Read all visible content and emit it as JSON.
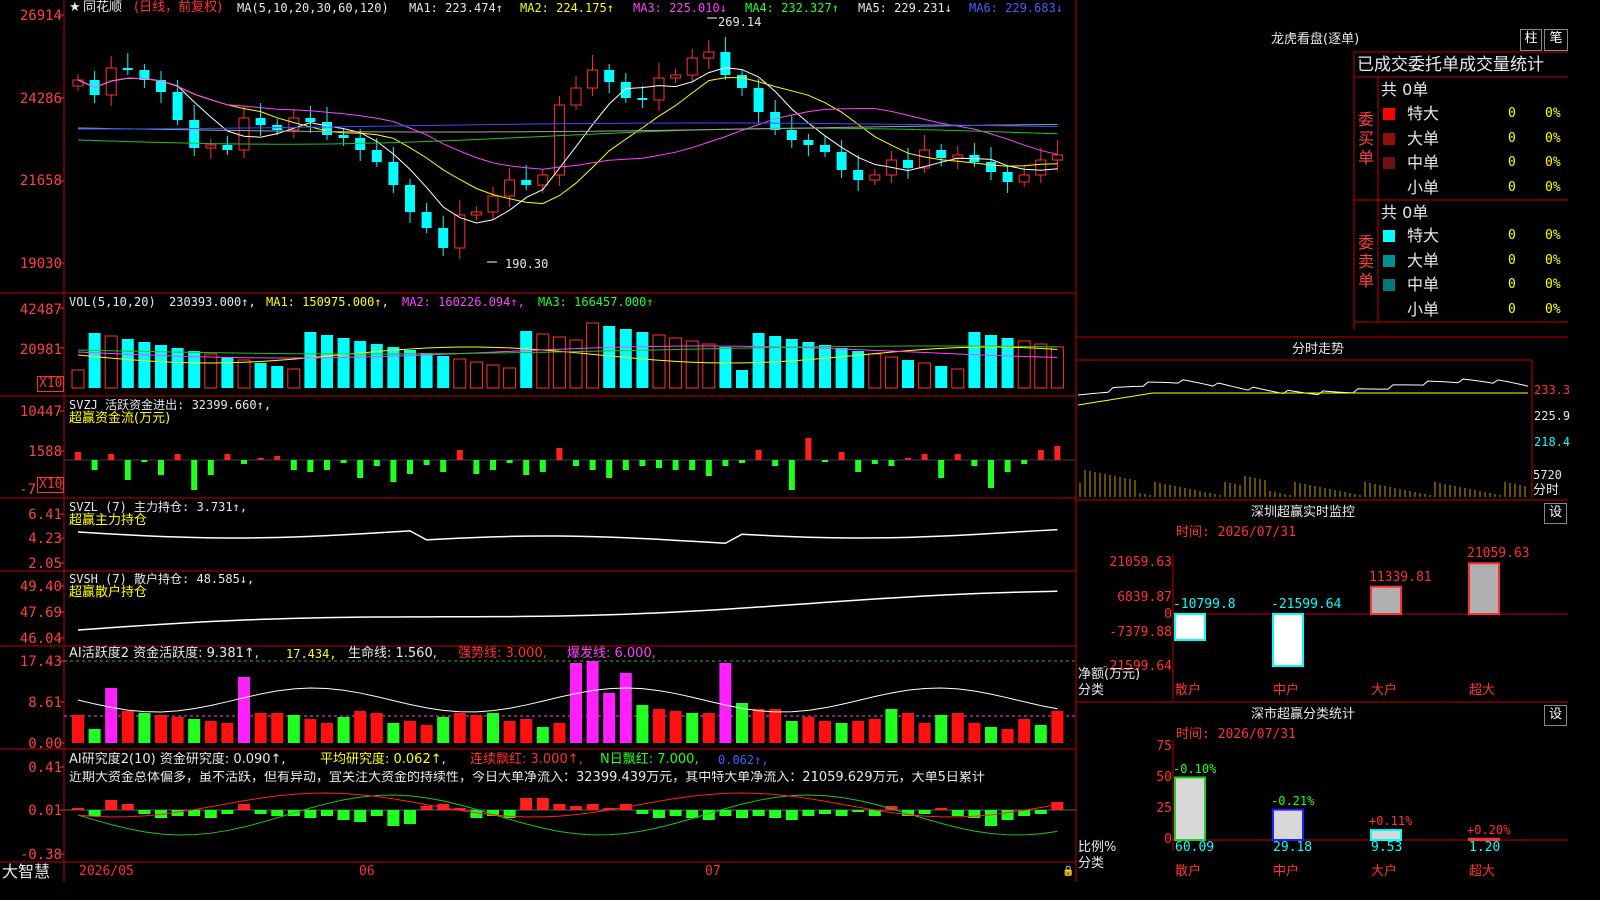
{
  "price_panel": {
    "axis": [
      "26914",
      "24286",
      "21658",
      "19030"
    ],
    "star": "★",
    "stock": "同花顺",
    "mode": "(日线，前复权)",
    "ma_title": "MA(5,10,20,30,60,120)",
    "ma1": "MA1: 223.474↑",
    "ma2": "MA2: 224.175↑",
    "ma3": "MA3: 225.010↓",
    "ma4": "MA4: 232.327↑",
    "ma5": "MA5: 229.231↓",
    "ma6": "MA6: 229.683↓",
    "high_mark": "269.14",
    "low_mark": "190.30"
  },
  "vol_panel": {
    "axis": [
      "42487",
      "20981"
    ],
    "multiplier": "X10",
    "title": "VOL(5,10,20)",
    "value": "230393.000↑,",
    "ma1": "MA1: 150975.000↑,",
    "ma2": "MA2: 160226.094↑,",
    "ma3": "MA3: 166457.000↑"
  },
  "svzj_panel": {
    "axis": [
      "10447",
      "1588",
      "-7"
    ],
    "multiplier": "X10",
    "line1": "SVZJ  活跃资金进出: 32399.660↑,",
    "line2": "超赢资金流(万元)"
  },
  "svzl_panel": {
    "axis": [
      "6.41",
      "4.23",
      "2.05"
    ],
    "line1": "SVZL (7) 主力持仓: 3.731↑,",
    "line2": "超赢主力持仓"
  },
  "svsh_panel": {
    "axis": [
      "49.40",
      "47.69",
      "46.04"
    ],
    "line1": "SVSH (7) 散户持仓: 48.585↓,",
    "line2": "超赢散户持仓"
  },
  "ai2_panel": {
    "axis": [
      "17.43",
      "8.61",
      "0.00"
    ],
    "t1": "AI活跃度2 资金活跃度: 9.381↑,",
    "t2": "17.434,",
    "t3": "生命线: 1.560,",
    "t4": "强势线: 3.000,",
    "t5": "爆发线: 6.000,"
  },
  "ai_research_panel": {
    "axis": [
      "0.41",
      "0.01",
      "-0.38"
    ],
    "t1": "AI研究度2(10) 资金研究度: 0.090↑,",
    "t2": "平均研究度: 0.062↑,",
    "t3": "连续飘红: 3.000↑,",
    "t4": "N日飘红: 7.000,",
    "t5": "0.062↑,",
    "comment": "近期大资金总体偏多，虽不活跃，但有异动，宜关注大资金的持续性，今日大单净流入：32399.439万元，其中特大单净流入：21059.629万元，大单5日累计"
  },
  "date_axis": {
    "brand": "大智慧",
    "d1": "2026/05",
    "d2": "06",
    "d3": "07"
  },
  "longhu": {
    "title": "龙虎看盘(逐单)",
    "btn_bar": "柱",
    "btn_pen": "笔",
    "subtitle": "已成交委托单成交量统计",
    "buy_label": "委买单",
    "sell_label": "委卖单",
    "buy_total": "共 0单",
    "sell_total": "共 0单",
    "buy_rows": [
      {
        "name": "特大",
        "count": "0",
        "pct": "0%",
        "color": "#ff0000"
      },
      {
        "name": "大单",
        "count": "0",
        "pct": "0%",
        "color": "#901010"
      },
      {
        "name": "中单",
        "count": "0",
        "pct": "0%",
        "color": "#701010"
      },
      {
        "name": "小单",
        "count": "0",
        "pct": "0%",
        "color": "#000000"
      }
    ],
    "sell_rows": [
      {
        "name": "特大",
        "count": "0",
        "pct": "0%",
        "color": "#00ffff"
      },
      {
        "name": "大单",
        "count": "0",
        "pct": "0%",
        "color": "#009090"
      },
      {
        "name": "中单",
        "count": "0",
        "pct": "0%",
        "color": "#007878"
      },
      {
        "name": "小单",
        "count": "0",
        "pct": "0%",
        "color": "#000000"
      }
    ]
  },
  "intraday": {
    "title": "分时走势",
    "p1": "233.3",
    "p2": "225.9",
    "p3": "218.4",
    "vol": "5720",
    "unit": "分时"
  },
  "monitor": {
    "title": "深圳超赢实时监控",
    "btn": "设",
    "time": "时间: 2026/07/31",
    "axis": [
      "21059.63",
      "6839.87",
      "0",
      "-7379.88",
      "-21599.64"
    ],
    "ylabel1": "净额(万元)",
    "ylabel2": "分类",
    "bars": [
      {
        "label": "散户",
        "value": "-10799.8"
      },
      {
        "label": "中户",
        "value": "-21599.64"
      },
      {
        "label": "大户",
        "value": "11339.81"
      },
      {
        "label": "超大",
        "value": "21059.63"
      }
    ]
  },
  "classify": {
    "title": "深市超赢分类统计",
    "btn": "设",
    "time": "时间: 2026/07/31",
    "axis": [
      "75",
      "50",
      "25",
      "0"
    ],
    "ylabel1": "比例%",
    "ylabel2": "分类",
    "bars": [
      {
        "label": "散户",
        "value": "60.09",
        "change": "-0.10%"
      },
      {
        "label": "中户",
        "value": "29.18",
        "change": "-0.21%"
      },
      {
        "label": "大户",
        "value": "9.53",
        "change": "+0.11%"
      },
      {
        "label": "超大",
        "value": "1.20",
        "change": "+0.20%"
      }
    ]
  }
}
